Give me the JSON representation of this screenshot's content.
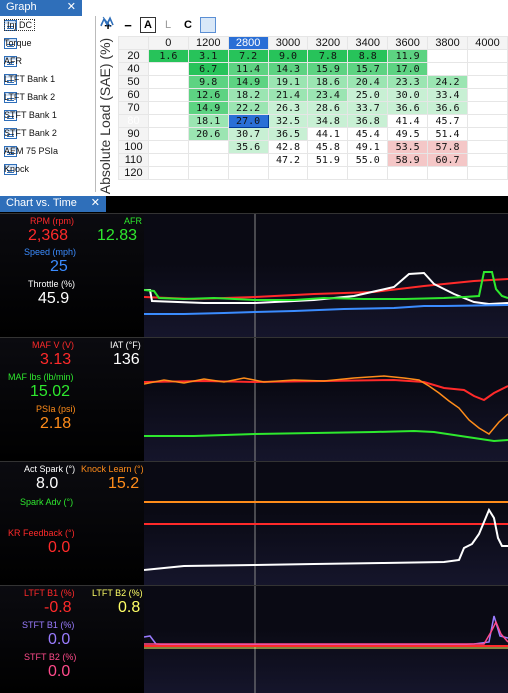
{
  "graph_tab": {
    "label": "Graph",
    "close": "✕"
  },
  "list_items": [
    {
      "label": "Inj DC",
      "icon": "table-icon"
    },
    {
      "label": "Torque",
      "icon": "table-icon"
    },
    {
      "label": "AFR",
      "icon": "table-icon"
    },
    {
      "label": "LTFT Bank 1",
      "icon": "table-icon"
    },
    {
      "label": "LTFT Bank 2",
      "icon": "table-icon"
    },
    {
      "label": "STFT Bank 1",
      "icon": "table-icon"
    },
    {
      "label": "STFT Bank 2",
      "icon": "table-icon"
    },
    {
      "label": "AEM 75 PSIa",
      "icon": "table-icon"
    },
    {
      "label": "Knock",
      "icon": "table-icon"
    }
  ],
  "toolbar": {
    "plus": "+",
    "minus": "−",
    "a": "A",
    "l": "L",
    "c": "C",
    "chart_icon": "line-chart-icon",
    "chart2_icon": "line-chart-alt-icon"
  },
  "y_axis_label": "Absolute Load (SAE) (%)",
  "columns": [
    "0",
    "1200",
    "2800",
    "3000",
    "3200",
    "3400",
    "3600",
    "3800",
    "4000"
  ],
  "rows": [
    {
      "h": "20",
      "cells": [
        "1.6",
        "3.1",
        "7.2",
        "9.0",
        "7.8",
        "8.8",
        "11.9",
        "",
        ""
      ]
    },
    {
      "h": "40",
      "cells": [
        "",
        "6.7",
        "11.4",
        "14.3",
        "15.9",
        "15.7",
        "17.0",
        "",
        ""
      ]
    },
    {
      "h": "50",
      "cells": [
        "",
        "9.8",
        "14.9",
        "19.1",
        "18.6",
        "20.4",
        "23.3",
        "24.2",
        ""
      ]
    },
    {
      "h": "60",
      "cells": [
        "",
        "12.6",
        "18.2",
        "21.4",
        "23.4",
        "25.0",
        "30.0",
        "33.4",
        ""
      ]
    },
    {
      "h": "70",
      "cells": [
        "",
        "14.9",
        "22.2",
        "26.3",
        "28.6",
        "33.7",
        "36.6",
        "36.6",
        ""
      ]
    },
    {
      "h": "80",
      "cells": [
        "",
        "18.1",
        "27.0",
        "32.5",
        "34.8",
        "36.8",
        "41.4",
        "45.7",
        ""
      ]
    },
    {
      "h": "90",
      "cells": [
        "",
        "20.6",
        "30.7",
        "36.5",
        "44.1",
        "45.4",
        "49.5",
        "51.4",
        ""
      ]
    },
    {
      "h": "100",
      "cells": [
        "",
        "",
        "35.6",
        "42.8",
        "45.8",
        "49.1",
        "53.5",
        "57.8",
        ""
      ]
    },
    {
      "h": "110",
      "cells": [
        "",
        "",
        "",
        "47.2",
        "51.9",
        "55.0",
        "58.9",
        "60.7",
        ""
      ]
    },
    {
      "h": "120",
      "cells": [
        "",
        "",
        "",
        "",
        "",
        "",
        "",
        "",
        ""
      ]
    }
  ],
  "chart_tab": {
    "label": "Chart vs. Time",
    "close": "✕"
  },
  "strip1": {
    "rpm_label": "RPM (rpm)",
    "rpm_value": "2,368",
    "afr_label": "AFR",
    "afr_value": "12.83",
    "speed_label": "Speed (mph)",
    "speed_value": "25",
    "throttle_label": "Throttle (%)",
    "throttle_value": "45.9"
  },
  "strip2": {
    "mafv_label": "MAF V (V)",
    "mafv_value": "3.13",
    "iat_label": "IAT (°F)",
    "iat_value": "136",
    "mafl_label": "MAF lbs (lb/min)",
    "mafl_value": "15.02",
    "psia_label": "PSIa (psi)",
    "psia_value": "2.18"
  },
  "strip3": {
    "spark_label": "Act Spark (°)",
    "spark_value": "8.0",
    "knock_label": "Knock Learn (°)",
    "knock_value": "15.2",
    "adv_label": "Spark Adv (°)",
    "kr_label": "KR Feedback (°)",
    "kr_value": "0.0"
  },
  "strip4": {
    "ltft1_label": "LTFT B1 (%)",
    "ltft1_value": "-0.8",
    "ltft2_label": "LTFT B2 (%)",
    "ltft2_value": "0.8",
    "stft1_label": "STFT B1 (%)",
    "stft1_value": "0.0",
    "stft2_label": "STFT B2 (%)",
    "stft2_value": "0.0"
  },
  "colors": {
    "red": "#ff2a2a",
    "green": "#2ee82e",
    "blue": "#3b8cff",
    "white": "#ffffff",
    "orange": "#ff8c1a",
    "yellow": "#ffff66",
    "purple": "#9a7cff",
    "pink": "#ff4b8b"
  }
}
